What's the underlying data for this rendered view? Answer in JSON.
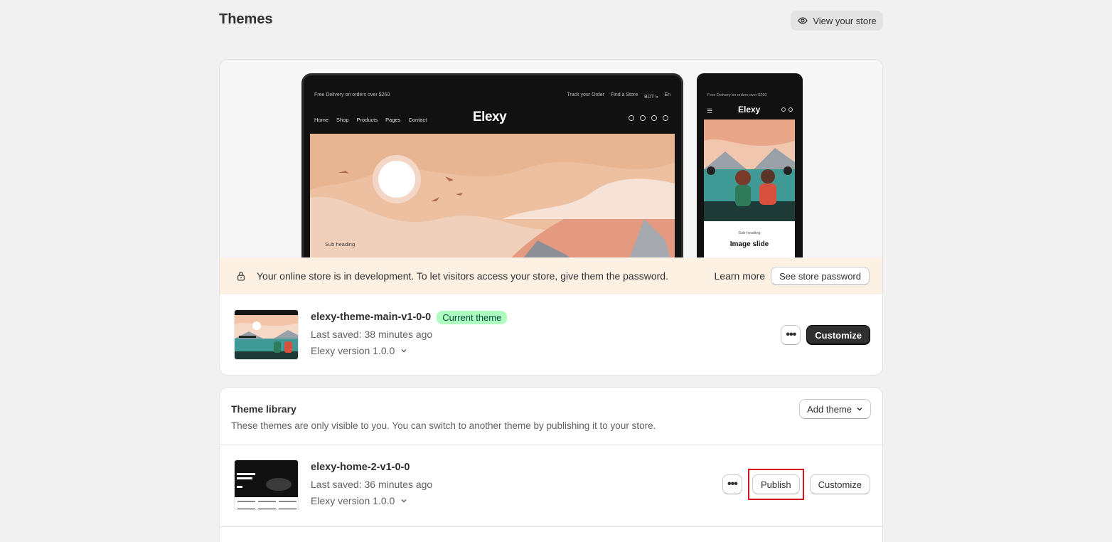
{
  "page": {
    "title": "Themes",
    "view_store_label": "View your store"
  },
  "preview": {
    "desktop": {
      "promo": "Free Delivery on orders over $260",
      "track": "Track your Order",
      "find_store": "Find a Store",
      "currency": "BDT ৳",
      "lang": "En",
      "nav": [
        "Home",
        "Shop",
        "Products",
        "Pages",
        "Contact"
      ],
      "logo": "Elexy",
      "sub_heading": "Sub heading"
    },
    "mobile": {
      "promo": "Free Delivery on orders over $260",
      "logo": "Elexy",
      "sub_heading": "Sub heading",
      "title": "Image slide"
    }
  },
  "banner": {
    "message": "Your online store is in development. To let visitors access your store, give them the password.",
    "learn_more": "Learn more",
    "button": "See store password"
  },
  "current_theme": {
    "name": "elexy-theme-main-v1-0-0",
    "badge": "Current theme",
    "last_saved": "Last saved: 38 minutes ago",
    "version": "Elexy version 1.0.0",
    "customize_label": "Customize",
    "more_label": "•••"
  },
  "library": {
    "heading": "Theme library",
    "description": "These themes are only visible to you. You can switch to another theme by publishing it to your store.",
    "add_theme_label": "Add theme",
    "themes": [
      {
        "name": "elexy-home-2-v1-0-0",
        "last_saved": "Last saved: 36 minutes ago",
        "version": "Elexy version 1.0.0",
        "publish_label": "Publish",
        "customize_label": "Customize",
        "more_label": "•••"
      }
    ]
  },
  "colors": {
    "background": "#f1f1f1",
    "banner": "#fdf1e3",
    "badge_bg": "#affebf",
    "primary_button": "#303030",
    "highlight": "#d8121a"
  }
}
